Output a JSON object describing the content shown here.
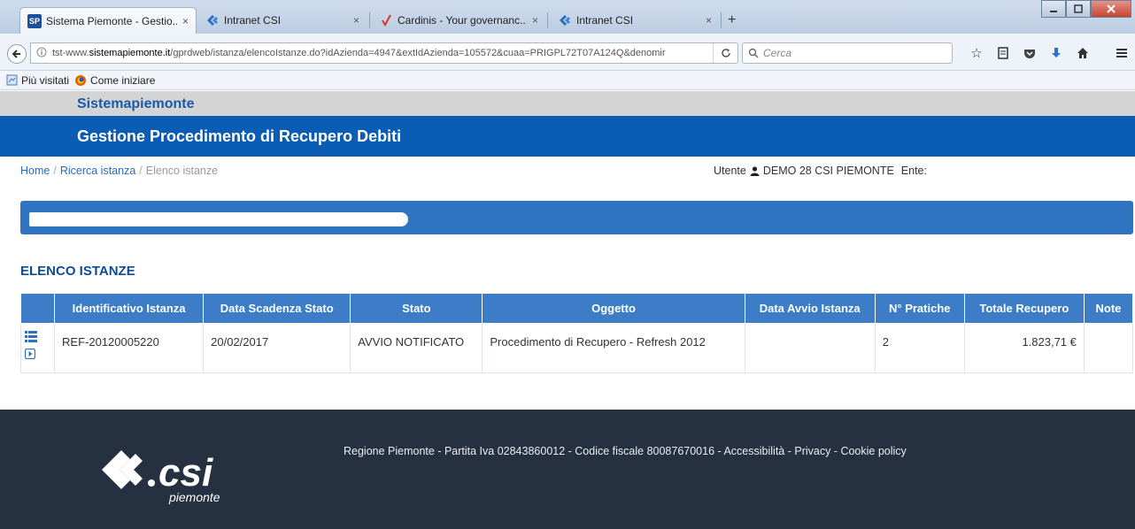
{
  "browser": {
    "tabs": [
      {
        "title": "Sistema Piemonte - Gestio...",
        "icon": "sp-favicon",
        "active": true
      },
      {
        "title": "Intranet CSI",
        "icon": "csi-favicon",
        "active": false
      },
      {
        "title": "Cardinis - Your governanc...",
        "icon": "cardinis-favicon",
        "active": false
      },
      {
        "title": "Intranet CSI",
        "icon": "csi-favicon",
        "active": false
      }
    ],
    "favicon_sp_text": "SP",
    "close_glyph": "×",
    "new_tab_glyph": "+",
    "url_prefix": "tst-www.",
    "url_host": "sistemapiemonte.it",
    "url_path": "/gprdweb/istanza/elencoIstanze.do?idAzienda=4947&extIdAzienda=105572&cuaa=PRIGPL72T07A124Q&denomir",
    "search_placeholder": "Cerca",
    "bookmarks": [
      "Più visitati",
      "Come iniziare"
    ]
  },
  "header": {
    "brand": "Sistemapiemonte",
    "title": "Gestione Procedimento di Recupero Debiti"
  },
  "breadcrumb": {
    "home": "Home",
    "ricerca": "Ricerca istanza",
    "current": "Elenco istanze",
    "separator": "/"
  },
  "user": {
    "label": "Utente",
    "name": "DEMO 28 CSI PIEMONTE",
    "ente_label": "Ente:"
  },
  "section": {
    "title": "ELENCO ISTANZE"
  },
  "table": {
    "columns": [
      "",
      "Identificativo Istanza",
      "Data Scadenza Stato",
      "Stato",
      "Oggetto",
      "Data Avvio Istanza",
      "N° Pratiche",
      "Totale Recupero",
      "Note"
    ],
    "rows": [
      {
        "id": "REF-20120005220",
        "scadenza": "20/02/2017",
        "stato": "AVVIO NOTIFICATO",
        "oggetto": "Procedimento di Recupero - Refresh 2012",
        "avvio": "",
        "pratiche": "2",
        "totale": "1.823,71 €",
        "note": ""
      }
    ]
  },
  "footer": {
    "logo_text": "csi",
    "logo_sub": "piemonte",
    "text": "Regione Piemonte - Partita Iva 02843860012 - Codice fiscale 80087670016 - ",
    "links": [
      "Accessibilità",
      "Privacy",
      "Cookie policy"
    ],
    "link_sep": " - "
  },
  "colors": {
    "banner": "#0b5cb4",
    "table_header": "#3d7dc7",
    "footer": "#253140"
  }
}
